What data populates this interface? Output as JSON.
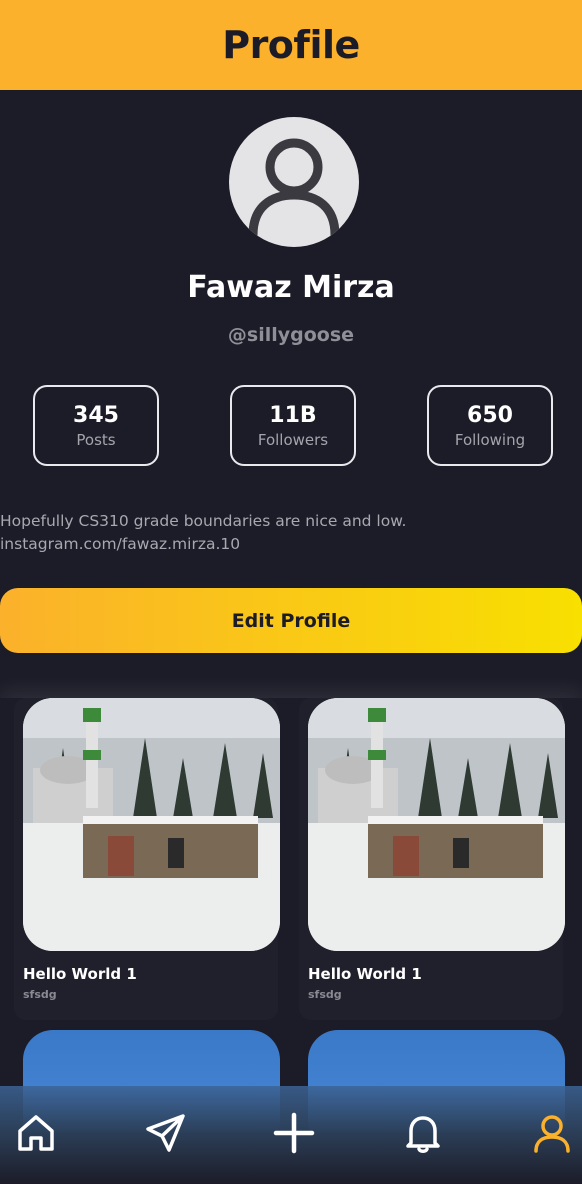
{
  "header": {
    "title": "Profile"
  },
  "profile": {
    "name": "Fawaz Mirza",
    "handle": "@sillygoose",
    "bio_line1": "Hopefully CS310 grade boundaries are nice and low.",
    "bio_line2": "instagram.com/fawaz.mirza.10"
  },
  "stats": [
    {
      "value": "345",
      "label": "Posts"
    },
    {
      "value": "11B",
      "label": "Followers"
    },
    {
      "value": "650",
      "label": "Following"
    }
  ],
  "edit_button": {
    "label": "Edit Profile"
  },
  "posts": [
    {
      "title": "Hello World 1",
      "subtitle": "sfsdg"
    },
    {
      "title": "Hello World 1",
      "subtitle": "sfsdg"
    }
  ],
  "tabbar": {
    "icons": [
      "home-icon",
      "send-icon",
      "plus-icon",
      "bell-icon",
      "profile-icon"
    ],
    "active": "profile-icon",
    "active_color": "#fbb12b",
    "inactive_color": "#ffffff"
  },
  "colors": {
    "accent": "#fbb12b",
    "accent_end": "#f8e000",
    "background": "#1c1c28"
  }
}
